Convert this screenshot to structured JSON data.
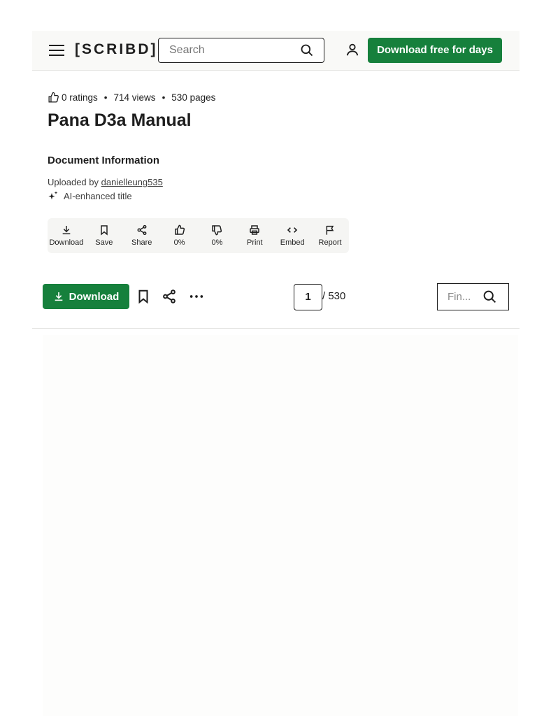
{
  "header": {
    "logo": "[SCRIBD]",
    "search_placeholder": "Search",
    "cta_label": "Download free for days"
  },
  "document": {
    "ratings": "0 ratings",
    "views": "714 views",
    "pages": "530 pages",
    "separator": "•",
    "title": "Pana D3a Manual",
    "info_heading": "Document Information",
    "uploaded_by_prefix": "Uploaded by",
    "uploader": "danielleung535",
    "ai_label": "AI-enhanced title"
  },
  "actions": [
    {
      "label": "Download",
      "icon": "download-icon"
    },
    {
      "label": "Save",
      "icon": "bookmark-icon"
    },
    {
      "label": "Share",
      "icon": "share-icon"
    },
    {
      "label": "0%",
      "icon": "thumbs-up-icon"
    },
    {
      "label": "0%",
      "icon": "thumbs-down-icon"
    },
    {
      "label": "Print",
      "icon": "printer-icon"
    },
    {
      "label": "Embed",
      "icon": "code-icon"
    },
    {
      "label": "Report",
      "icon": "flag-icon"
    }
  ],
  "viewer": {
    "download_label": "Download",
    "current_page": "1",
    "total_pages": "/ 530",
    "find_placeholder": "Fin..."
  },
  "colors": {
    "brand_green": "#16803c",
    "text": "#1e1e1e",
    "header_bg": "#f9f9f7"
  }
}
